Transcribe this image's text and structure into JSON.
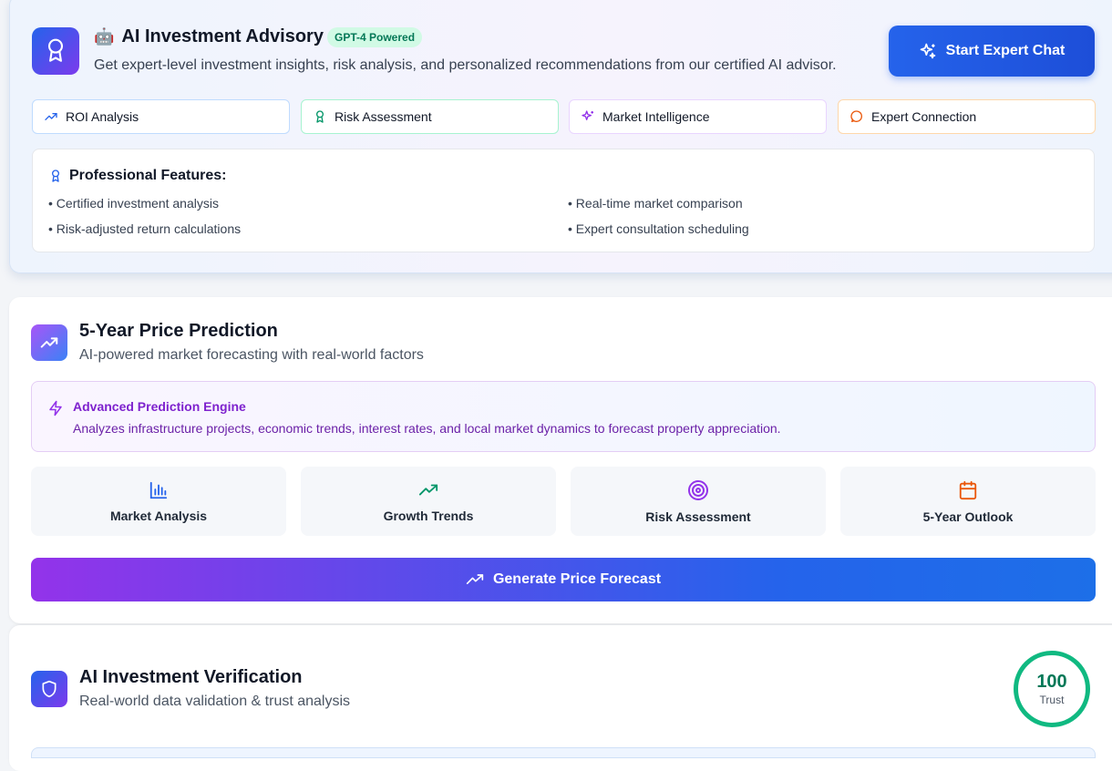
{
  "advisory": {
    "title": "AI Investment Advisory",
    "robot_glyph": "🤖",
    "badge": "GPT-4 Powered",
    "subtitle": "Get expert-level investment insights, risk analysis, and personalized recommendations from our certified AI advisor.",
    "expert_button": "Start Expert Chat",
    "chips": [
      {
        "label": "ROI Analysis",
        "icon": "trending-up-icon",
        "color": "#2563eb"
      },
      {
        "label": "Risk Assessment",
        "icon": "award-icon",
        "color": "#059669"
      },
      {
        "label": "Market Intelligence",
        "icon": "sparkles-icon",
        "color": "#9333ea"
      },
      {
        "label": "Expert Connection",
        "icon": "message-circle-icon",
        "color": "#ea580c"
      }
    ],
    "features": {
      "title": "Professional Features:",
      "items": [
        "• Certified investment analysis",
        "• Real-time market comparison",
        "• Risk-adjusted return calculations",
        "• Expert consultation scheduling"
      ]
    }
  },
  "prediction": {
    "title": "5-Year Price Prediction",
    "subtitle": "AI-powered market forecasting with real-world factors",
    "engine_title": "Advanced Prediction Engine",
    "engine_desc": "Analyzes infrastructure projects, economic trends, interest rates, and local market dynamics to forecast property appreciation.",
    "metrics": [
      {
        "label": "Market Analysis",
        "icon": "bar-chart-icon",
        "color": "#2563eb"
      },
      {
        "label": "Growth Trends",
        "icon": "trending-up-icon",
        "color": "#059669"
      },
      {
        "label": "Risk Assessment",
        "icon": "target-icon",
        "color": "#9333ea"
      },
      {
        "label": "5-Year Outlook",
        "icon": "calendar-icon",
        "color": "#ea580c"
      }
    ],
    "button": "Generate Price Forecast"
  },
  "verification": {
    "title": "AI Investment Verification",
    "subtitle": "Real-world data validation & trust analysis",
    "trust_score": "100",
    "trust_label": "Trust"
  }
}
